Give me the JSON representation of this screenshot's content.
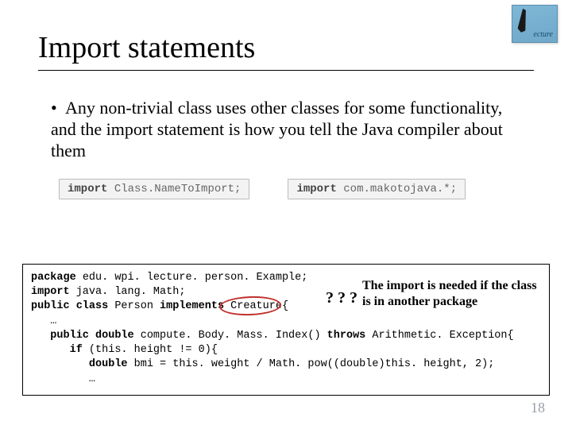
{
  "logo": {
    "text": "ecture"
  },
  "title": "Import statements",
  "bullet": "Any non-trivial class uses other classes for some functionality, and the import statement is how you tell the Java compiler about them",
  "snippet1": {
    "kw": "import",
    "rest": " Class.NameToImport;"
  },
  "snippet2": {
    "kw": "import",
    "rest": " com.makotojava.*;"
  },
  "code": {
    "l1_kw": "package",
    "l1_rest": " edu. wpi. lecture. person. Example;",
    "l2_kw": "import",
    "l2_rest": " java. lang. Math;",
    "l3_kw1": "public class",
    "l3_mid": " Person ",
    "l3_kw2": "implements",
    "l3_creature": " Creature",
    "l3_brace": "{",
    "l4": "   …",
    "l5_kw": "   public double",
    "l5_mid": " compute. Body. Mass. Index() ",
    "l5_kw2": "throws",
    "l5_rest": " Arithmetic. Exception{",
    "l6_kw": "      if",
    "l6_rest": " (this. height != 0){",
    "l7_kw": "         double",
    "l7_rest": " bmi = this. weight / Math. pow((double)this. height, 2);",
    "l8": "         …"
  },
  "qqq": "? ? ?",
  "note": "The import is needed if the class is in another package",
  "page": "18"
}
